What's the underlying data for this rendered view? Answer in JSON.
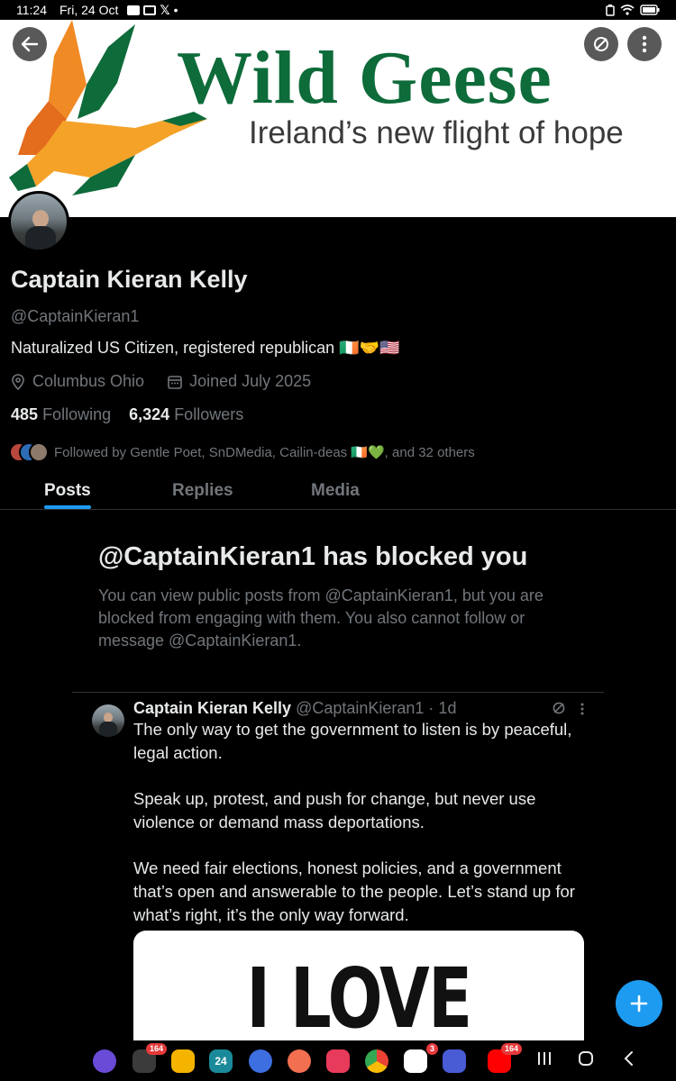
{
  "status_bar": {
    "time": "11:24",
    "date": "Fri, 24 Oct"
  },
  "banner": {
    "title": "Wild Geese",
    "subtitle": "Ireland’s new flight of hope",
    "title_color": "#0e6b3a"
  },
  "profile": {
    "name": "Captain Kieran Kelly",
    "handle": "@CaptainKieran1",
    "bio": "Naturalized US Citizen, registered republican 🇮🇪🤝🇺🇸",
    "location": "Columbus Ohio",
    "joined": "Joined July 2025",
    "following_count": "485",
    "following_label": "Following",
    "followers_count": "6,324",
    "followers_label": "Followers",
    "followed_by": "Followed by Gentle Poet, SnDMedia, Cailin-deas 🇮🇪💚, and 32 others"
  },
  "tabs": [
    {
      "label": "Posts",
      "active": true
    },
    {
      "label": "Replies",
      "active": false
    },
    {
      "label": "Media",
      "active": false
    }
  ],
  "blocked": {
    "title": "@CaptainKieran1 has blocked you",
    "description": "You can view public posts from @CaptainKieran1, but you are blocked from engaging with them. You also cannot follow or message @CaptainKieran1."
  },
  "post": {
    "author": "Captain Kieran Kelly",
    "handle_time": "@CaptainKieran1 · 1d",
    "paragraphs": [
      "The only way to get the government to listen is by peaceful, legal action.",
      "Speak up, protest, and push for change, but never use violence or demand mass deportations.",
      "We need fair elections, honest policies, and a government that’s open and answerable to the people. Let’s stand up for what’s right, it’s the only way forward."
    ],
    "image_text": "I LOVE"
  },
  "dock": {
    "badges": {
      "multi": "164",
      "gmail": "3",
      "youtube": "164"
    },
    "calendar_day": "24"
  },
  "colors": {
    "accent": "#1d9bf0",
    "text_primary": "#e7e9ea",
    "text_secondary": "#71767b",
    "background": "#000000"
  }
}
